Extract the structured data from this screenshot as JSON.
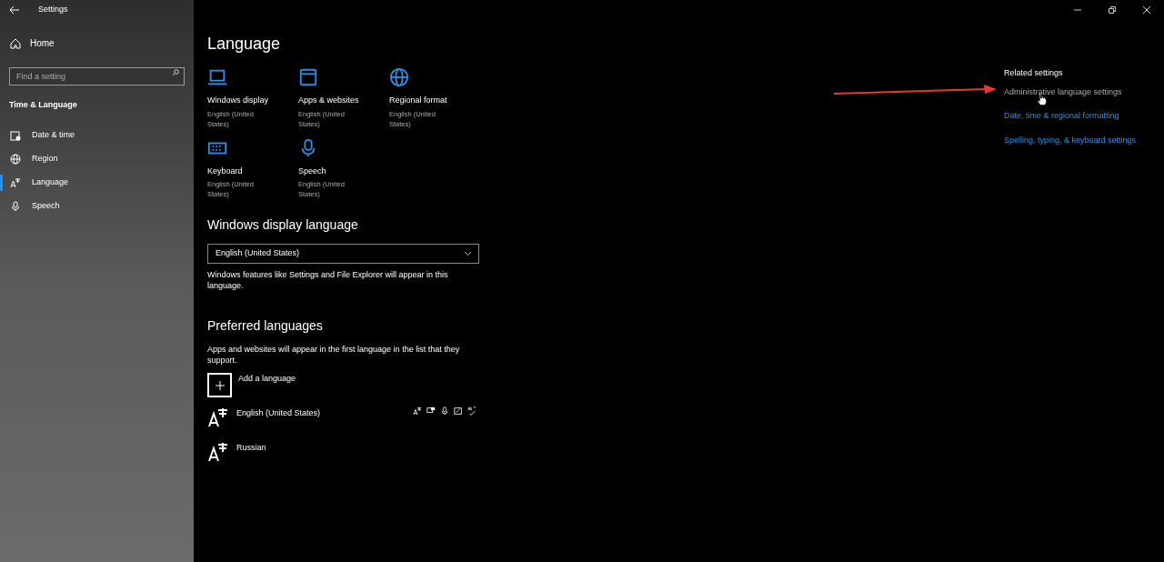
{
  "window": {
    "title": "Settings"
  },
  "sidebar": {
    "home": "Home",
    "search": {
      "placeholder": "Find a setting"
    },
    "section": "Time & Language",
    "items": [
      {
        "label": "Date & time",
        "kind": "clock",
        "selected": false
      },
      {
        "label": "Region",
        "kind": "globe",
        "selected": false
      },
      {
        "label": "Language",
        "kind": "language",
        "selected": true
      },
      {
        "label": "Speech",
        "kind": "mic",
        "selected": false
      }
    ]
  },
  "page": {
    "title": "Language",
    "tiles": [
      {
        "kind": "laptop",
        "title": "Windows display",
        "subtitle": "English (United States)"
      },
      {
        "kind": "window",
        "title": "Apps & websites",
        "subtitle": "English (United States)"
      },
      {
        "kind": "globe",
        "title": "Regional format",
        "subtitle": "English (United States)"
      },
      {
        "kind": "keyboard",
        "title": "Keyboard",
        "subtitle": "English (United States)"
      },
      {
        "kind": "mic",
        "title": "Speech",
        "subtitle": "English (United States)"
      }
    ],
    "display_language": {
      "heading": "Windows display language",
      "value": "English (United States)",
      "note": "Windows features like Settings and File Explorer will appear in this language."
    },
    "preferred": {
      "heading": "Preferred languages",
      "note": "Apps and websites will appear in the first language in the list that they support.",
      "add": "Add a language",
      "languages": [
        {
          "name": "English (United States)",
          "features": [
            {
              "kind": "language"
            },
            {
              "kind": "display"
            },
            {
              "kind": "mic"
            },
            {
              "kind": "handwriting"
            },
            {
              "kind": "spelling"
            }
          ]
        },
        {
          "name": "Russian"
        }
      ]
    }
  },
  "related": {
    "heading": "Related settings",
    "links": [
      {
        "label": "Administrative language settings",
        "hovered": true
      },
      {
        "label": "Date, time & regional formatting",
        "hovered": false
      },
      {
        "label": "Spelling, typing, & keyboard settings",
        "hovered": false
      }
    ]
  }
}
